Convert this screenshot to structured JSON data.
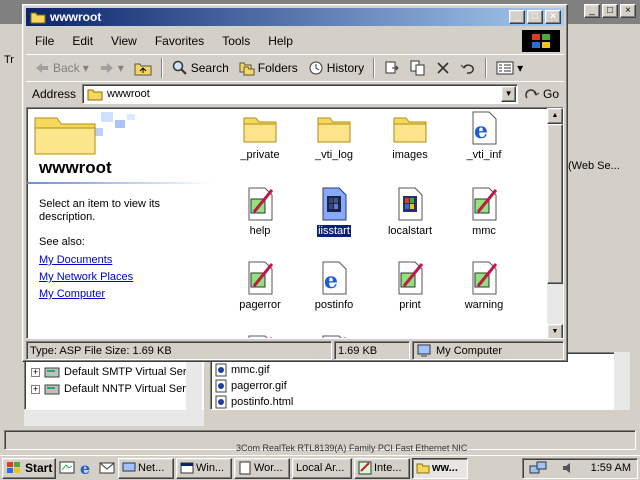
{
  "background": {
    "menu_fragment": "Tr",
    "right_text": "(Web Se...",
    "tree_items": [
      "Default SMTP Virtual Serv",
      "Default NNTP Virtual Serv"
    ],
    "list_items": [
      "mmc.gif",
      "pagerror.gif",
      "postinfo.html"
    ],
    "status_fragment": "3Com RealTek RTL8139(A) Family PCI Fast Ethernet NIC"
  },
  "window": {
    "title": "wwwroot",
    "menu": [
      "File",
      "Edit",
      "View",
      "Favorites",
      "Tools",
      "Help"
    ],
    "toolbar": {
      "back": "Back",
      "search": "Search",
      "folders": "Folders",
      "history": "History"
    },
    "address": {
      "label": "Address",
      "value": "wwwroot",
      "go": "Go"
    },
    "webview": {
      "folder_name": "wwwroot",
      "description": "Select an item to view its description.",
      "see_also": "See also:",
      "links": [
        "My Documents",
        "My Network Places",
        "My Computer"
      ]
    },
    "files": [
      {
        "name": "_private",
        "icon": "folder-icon"
      },
      {
        "name": "_vti_log",
        "icon": "folder-icon"
      },
      {
        "name": "images",
        "icon": "folder-icon"
      },
      {
        "name": "_vti_inf",
        "icon": "ie-html-icon"
      },
      {
        "name": "help",
        "icon": "gif-image-icon"
      },
      {
        "name": "iisstart",
        "icon": "asp-file-icon",
        "selected": true
      },
      {
        "name": "localstart",
        "icon": "asp-file-icon"
      },
      {
        "name": "mmc",
        "icon": "gif-image-icon"
      },
      {
        "name": "pagerror",
        "icon": "gif-image-icon"
      },
      {
        "name": "postinfo",
        "icon": "ie-html-icon"
      },
      {
        "name": "print",
        "icon": "gif-image-icon"
      },
      {
        "name": "warning",
        "icon": "gif-image-icon"
      }
    ],
    "status": {
      "type": "Type: ASP File Size: 1.69 KB",
      "size": "1.69 KB",
      "zone": "My Computer"
    }
  },
  "taskbar": {
    "start": "Start",
    "tasks": [
      "Net...",
      "Win...",
      "Wor...",
      "Local Ar...",
      "Inte...",
      "ww..."
    ],
    "active_task": 5,
    "clock": "1:59 AM"
  },
  "colors": {
    "title_active": "#0a246a",
    "selection": "#0a246a",
    "link": "#0000cc",
    "face": "#d4d0c8"
  }
}
